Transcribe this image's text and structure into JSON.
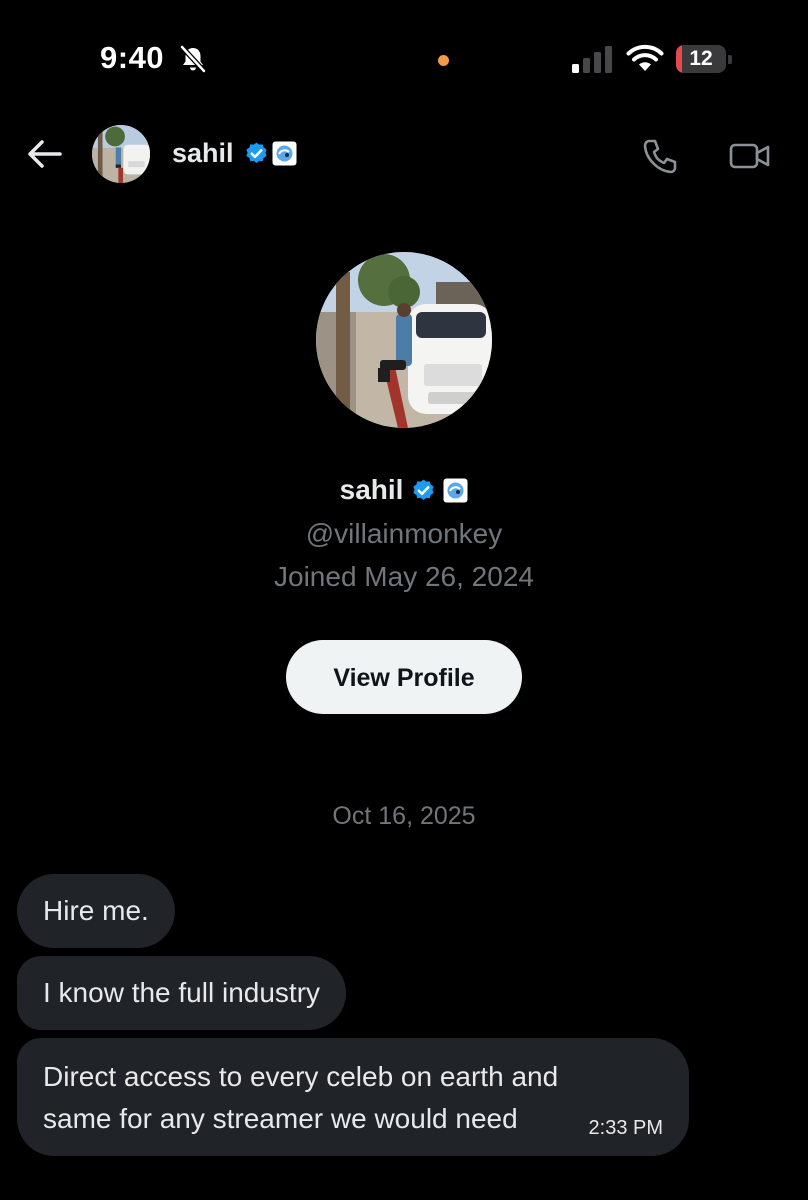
{
  "status_bar": {
    "time": "9:40",
    "battery_level": "12",
    "battery_fraction": 0.12,
    "icons": [
      "bell-slash-icon",
      "signal-icon",
      "wifi-icon",
      "battery-icon"
    ],
    "colors": {
      "battery_low": "#e5484d",
      "orange_dot": "#f2994a"
    }
  },
  "header": {
    "name": "sahil",
    "icons": [
      "back-arrow-icon",
      "verified-badge-icon",
      "affiliate-badge-icon",
      "phone-icon",
      "video-camera-icon"
    ]
  },
  "profile": {
    "name": "sahil",
    "handle": "@villainmonkey",
    "joined": "Joined May 26, 2024",
    "view_profile_label": "View Profile"
  },
  "conversation": {
    "date": "Oct 16, 2025",
    "messages": [
      {
        "text": "Hire me."
      },
      {
        "text": "I know the full industry"
      },
      {
        "text": "Direct access to every celeb on earth and same for any streamer we would need",
        "time": "2:33 PM"
      }
    ]
  },
  "colors": {
    "background": "#000000",
    "bubble": "#202327",
    "secondary_text": "#71767b",
    "verified_blue": "#1d9bf0"
  }
}
